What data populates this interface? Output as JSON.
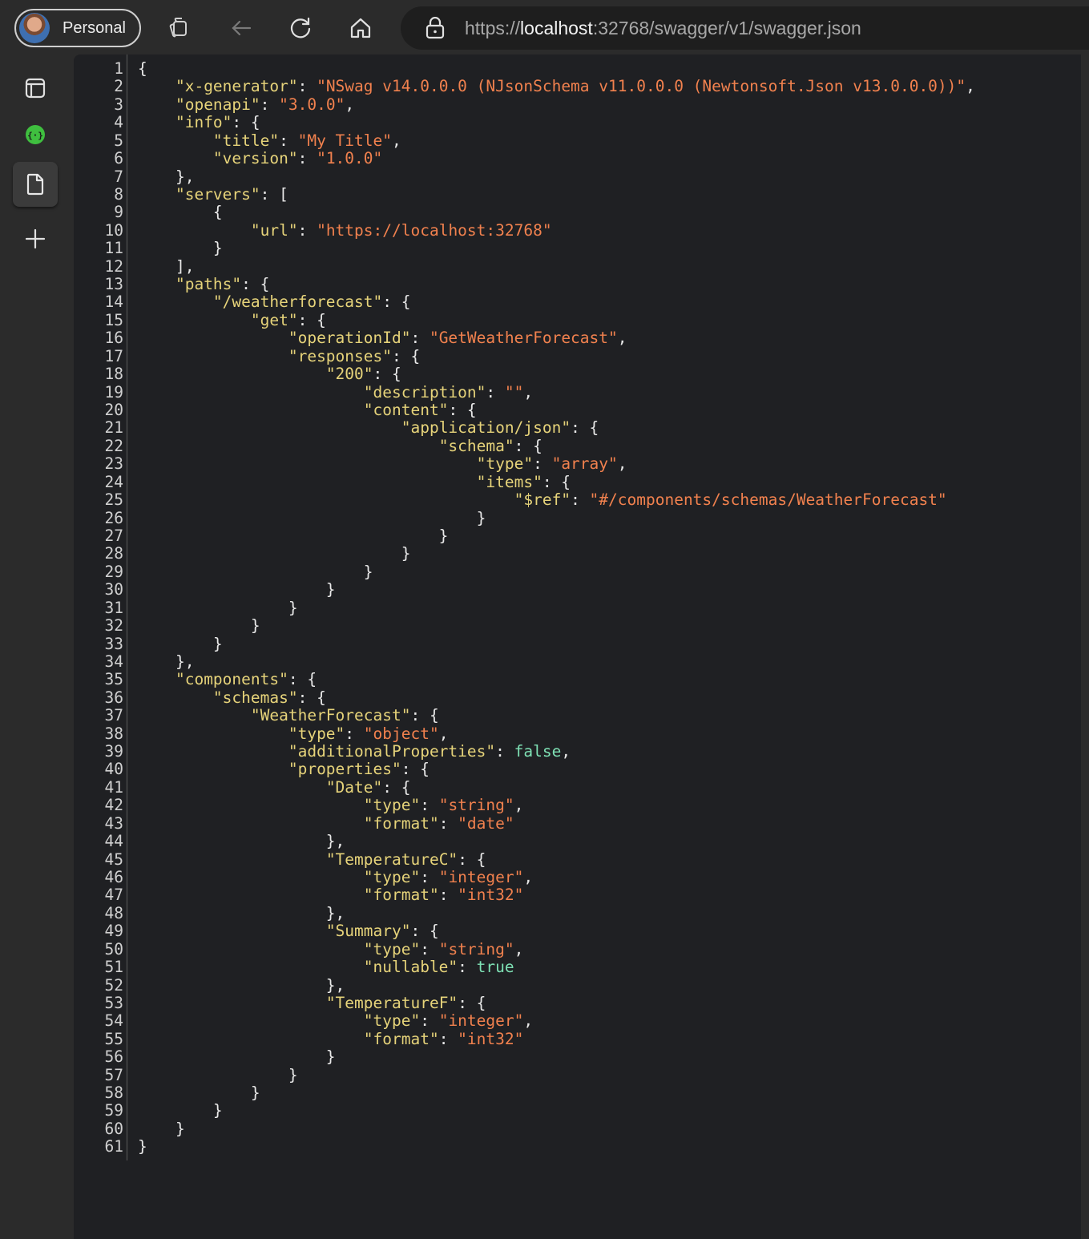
{
  "browser": {
    "profile_label": "Personal",
    "url_prefix": "https://",
    "url_host": "localhost",
    "url_rest": ":32768/swagger/v1/swagger.json"
  },
  "sidebar": {
    "items": [
      "tab-actions-icon",
      "json-extension-icon",
      "document-icon",
      "add-icon"
    ]
  },
  "colors": {
    "key": "#e6d37a",
    "string": "#f1814e",
    "boolean": "#7ee0b4",
    "punctuation": "#e8e8e8"
  },
  "code": [
    [
      [
        "p",
        "{"
      ]
    ],
    [
      [
        "p",
        "    "
      ],
      [
        "k",
        "\"x-generator\""
      ],
      [
        "p",
        ": "
      ],
      [
        "s",
        "\"NSwag v14.0.0.0 (NJsonSchema v11.0.0.0 (Newtonsoft.Json v13.0.0.0))\""
      ],
      [
        "p",
        ","
      ]
    ],
    [
      [
        "p",
        "    "
      ],
      [
        "k",
        "\"openapi\""
      ],
      [
        "p",
        ": "
      ],
      [
        "s",
        "\"3.0.0\""
      ],
      [
        "p",
        ","
      ]
    ],
    [
      [
        "p",
        "    "
      ],
      [
        "k",
        "\"info\""
      ],
      [
        "p",
        ": {"
      ]
    ],
    [
      [
        "p",
        "        "
      ],
      [
        "k",
        "\"title\""
      ],
      [
        "p",
        ": "
      ],
      [
        "s",
        "\"My Title\""
      ],
      [
        "p",
        ","
      ]
    ],
    [
      [
        "p",
        "        "
      ],
      [
        "k",
        "\"version\""
      ],
      [
        "p",
        ": "
      ],
      [
        "s",
        "\"1.0.0\""
      ]
    ],
    [
      [
        "p",
        "    },"
      ]
    ],
    [
      [
        "p",
        "    "
      ],
      [
        "k",
        "\"servers\""
      ],
      [
        "p",
        ": ["
      ]
    ],
    [
      [
        "p",
        "        {"
      ]
    ],
    [
      [
        "p",
        "            "
      ],
      [
        "k",
        "\"url\""
      ],
      [
        "p",
        ": "
      ],
      [
        "s",
        "\"https://localhost:32768\""
      ]
    ],
    [
      [
        "p",
        "        }"
      ]
    ],
    [
      [
        "p",
        "    ],"
      ]
    ],
    [
      [
        "p",
        "    "
      ],
      [
        "k",
        "\"paths\""
      ],
      [
        "p",
        ": {"
      ]
    ],
    [
      [
        "p",
        "        "
      ],
      [
        "k",
        "\"/weatherforecast\""
      ],
      [
        "p",
        ": {"
      ]
    ],
    [
      [
        "p",
        "            "
      ],
      [
        "k",
        "\"get\""
      ],
      [
        "p",
        ": {"
      ]
    ],
    [
      [
        "p",
        "                "
      ],
      [
        "k",
        "\"operationId\""
      ],
      [
        "p",
        ": "
      ],
      [
        "s",
        "\"GetWeatherForecast\""
      ],
      [
        "p",
        ","
      ]
    ],
    [
      [
        "p",
        "                "
      ],
      [
        "k",
        "\"responses\""
      ],
      [
        "p",
        ": {"
      ]
    ],
    [
      [
        "p",
        "                    "
      ],
      [
        "k",
        "\"200\""
      ],
      [
        "p",
        ": {"
      ]
    ],
    [
      [
        "p",
        "                        "
      ],
      [
        "k",
        "\"description\""
      ],
      [
        "p",
        ": "
      ],
      [
        "s",
        "\"\""
      ],
      [
        "p",
        ","
      ]
    ],
    [
      [
        "p",
        "                        "
      ],
      [
        "k",
        "\"content\""
      ],
      [
        "p",
        ": {"
      ]
    ],
    [
      [
        "p",
        "                            "
      ],
      [
        "k",
        "\"application/json\""
      ],
      [
        "p",
        ": {"
      ]
    ],
    [
      [
        "p",
        "                                "
      ],
      [
        "k",
        "\"schema\""
      ],
      [
        "p",
        ": {"
      ]
    ],
    [
      [
        "p",
        "                                    "
      ],
      [
        "k",
        "\"type\""
      ],
      [
        "p",
        ": "
      ],
      [
        "s",
        "\"array\""
      ],
      [
        "p",
        ","
      ]
    ],
    [
      [
        "p",
        "                                    "
      ],
      [
        "k",
        "\"items\""
      ],
      [
        "p",
        ": {"
      ]
    ],
    [
      [
        "p",
        "                                        "
      ],
      [
        "k",
        "\"$ref\""
      ],
      [
        "p",
        ": "
      ],
      [
        "s",
        "\"#/components/schemas/WeatherForecast\""
      ]
    ],
    [
      [
        "p",
        "                                    }"
      ]
    ],
    [
      [
        "p",
        "                                }"
      ]
    ],
    [
      [
        "p",
        "                            }"
      ]
    ],
    [
      [
        "p",
        "                        }"
      ]
    ],
    [
      [
        "p",
        "                    }"
      ]
    ],
    [
      [
        "p",
        "                }"
      ]
    ],
    [
      [
        "p",
        "            }"
      ]
    ],
    [
      [
        "p",
        "        }"
      ]
    ],
    [
      [
        "p",
        "    },"
      ]
    ],
    [
      [
        "p",
        "    "
      ],
      [
        "k",
        "\"components\""
      ],
      [
        "p",
        ": {"
      ]
    ],
    [
      [
        "p",
        "        "
      ],
      [
        "k",
        "\"schemas\""
      ],
      [
        "p",
        ": {"
      ]
    ],
    [
      [
        "p",
        "            "
      ],
      [
        "k",
        "\"WeatherForecast\""
      ],
      [
        "p",
        ": {"
      ]
    ],
    [
      [
        "p",
        "                "
      ],
      [
        "k",
        "\"type\""
      ],
      [
        "p",
        ": "
      ],
      [
        "s",
        "\"object\""
      ],
      [
        "p",
        ","
      ]
    ],
    [
      [
        "p",
        "                "
      ],
      [
        "k",
        "\"additionalProperties\""
      ],
      [
        "p",
        ": "
      ],
      [
        "b",
        "false"
      ],
      [
        "p",
        ","
      ]
    ],
    [
      [
        "p",
        "                "
      ],
      [
        "k",
        "\"properties\""
      ],
      [
        "p",
        ": {"
      ]
    ],
    [
      [
        "p",
        "                    "
      ],
      [
        "k",
        "\"Date\""
      ],
      [
        "p",
        ": {"
      ]
    ],
    [
      [
        "p",
        "                        "
      ],
      [
        "k",
        "\"type\""
      ],
      [
        "p",
        ": "
      ],
      [
        "s",
        "\"string\""
      ],
      [
        "p",
        ","
      ]
    ],
    [
      [
        "p",
        "                        "
      ],
      [
        "k",
        "\"format\""
      ],
      [
        "p",
        ": "
      ],
      [
        "s",
        "\"date\""
      ]
    ],
    [
      [
        "p",
        "                    },"
      ]
    ],
    [
      [
        "p",
        "                    "
      ],
      [
        "k",
        "\"TemperatureC\""
      ],
      [
        "p",
        ": {"
      ]
    ],
    [
      [
        "p",
        "                        "
      ],
      [
        "k",
        "\"type\""
      ],
      [
        "p",
        ": "
      ],
      [
        "s",
        "\"integer\""
      ],
      [
        "p",
        ","
      ]
    ],
    [
      [
        "p",
        "                        "
      ],
      [
        "k",
        "\"format\""
      ],
      [
        "p",
        ": "
      ],
      [
        "s",
        "\"int32\""
      ]
    ],
    [
      [
        "p",
        "                    },"
      ]
    ],
    [
      [
        "p",
        "                    "
      ],
      [
        "k",
        "\"Summary\""
      ],
      [
        "p",
        ": {"
      ]
    ],
    [
      [
        "p",
        "                        "
      ],
      [
        "k",
        "\"type\""
      ],
      [
        "p",
        ": "
      ],
      [
        "s",
        "\"string\""
      ],
      [
        "p",
        ","
      ]
    ],
    [
      [
        "p",
        "                        "
      ],
      [
        "k",
        "\"nullable\""
      ],
      [
        "p",
        ": "
      ],
      [
        "b",
        "true"
      ]
    ],
    [
      [
        "p",
        "                    },"
      ]
    ],
    [
      [
        "p",
        "                    "
      ],
      [
        "k",
        "\"TemperatureF\""
      ],
      [
        "p",
        ": {"
      ]
    ],
    [
      [
        "p",
        "                        "
      ],
      [
        "k",
        "\"type\""
      ],
      [
        "p",
        ": "
      ],
      [
        "s",
        "\"integer\""
      ],
      [
        "p",
        ","
      ]
    ],
    [
      [
        "p",
        "                        "
      ],
      [
        "k",
        "\"format\""
      ],
      [
        "p",
        ": "
      ],
      [
        "s",
        "\"int32\""
      ]
    ],
    [
      [
        "p",
        "                    }"
      ]
    ],
    [
      [
        "p",
        "                }"
      ]
    ],
    [
      [
        "p",
        "            }"
      ]
    ],
    [
      [
        "p",
        "        }"
      ]
    ],
    [
      [
        "p",
        "    }"
      ]
    ],
    [
      [
        "p",
        "}"
      ]
    ]
  ]
}
